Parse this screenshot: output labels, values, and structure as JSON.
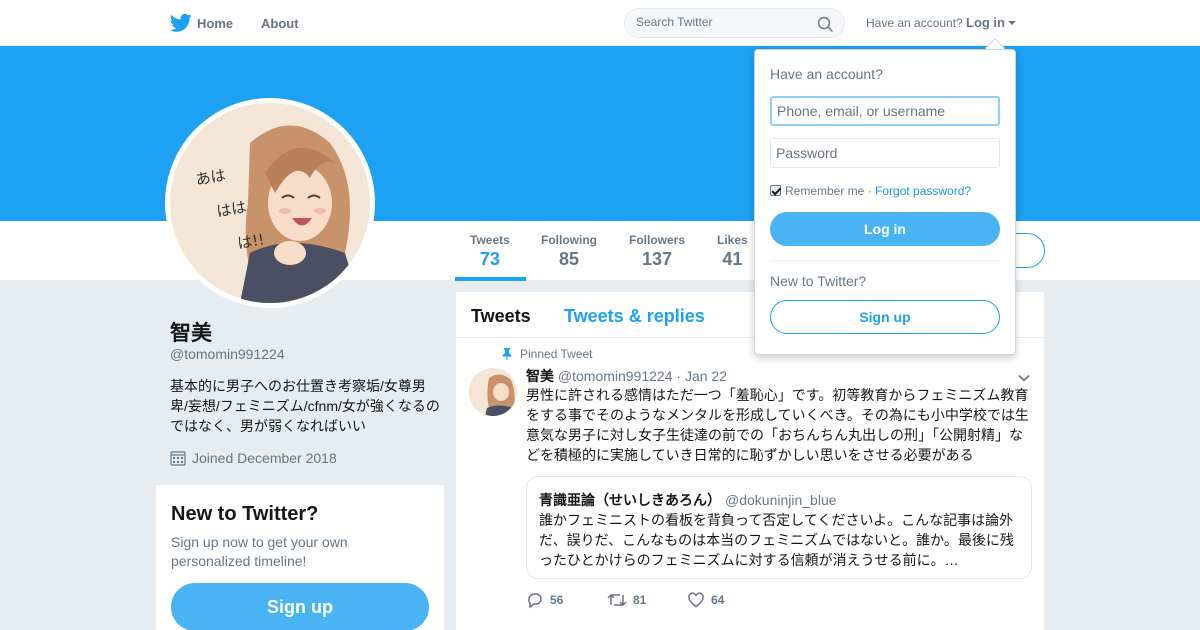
{
  "nav": {
    "home": "Home",
    "about": "About",
    "search_placeholder": "Search Twitter",
    "have_account": "Have an account?",
    "login": "Log in"
  },
  "profile": {
    "name": "智美",
    "handle": "@tomomin991224",
    "bio": "基本的に男子へのお仕置き考察垢/女尊男卑/妄想/フェミニズム/cfnm/女が強くなるのではなく、男が弱くなればいい",
    "joined": "Joined December 2018",
    "avatar_text": "あはははは!!"
  },
  "stats": [
    {
      "label": "Tweets",
      "value": "73"
    },
    {
      "label": "Following",
      "value": "85"
    },
    {
      "label": "Followers",
      "value": "137"
    },
    {
      "label": "Likes",
      "value": "41"
    }
  ],
  "signup_card": {
    "title": "New to Twitter?",
    "subtitle": "Sign up now to get your own personalized timeline!",
    "button": "Sign up"
  },
  "timeline": {
    "tabs": [
      "Tweets",
      "Tweets & replies"
    ],
    "tweet": {
      "pinned_label": "Pinned Tweet",
      "author": "智美",
      "meta": "@tomomin991224 · Jan 22",
      "text": "男性に許される感情はただ一つ「羞恥心」です。初等教育からフェミニズム教育をする事でそのようなメンタルを形成していくべき。その為にも小中学校では生意気な男子に対し女子生徒達の前での「おちんちん丸出しの刑」「公開射精」などを積極的に実施していき日常的に恥ずかしい思いをさせる必要がある",
      "quote": {
        "name": "青識亜論（せいしきあろん）",
        "handle": "@dokuninjin_blue",
        "text": "誰かフェミニストの看板を背負って否定してくださいよ。こんな記事は論外だ、誤りだ、こんなものは本当のフェミニズムではないと。誰か。最後に残ったひとかけらのフェミニズムに対する信頼が消えうせる前に。…"
      },
      "replies": "56",
      "retweets": "81",
      "likes": "64"
    }
  },
  "login_dropdown": {
    "title": "Have an account?",
    "username_placeholder": "Phone, email, or username",
    "password_placeholder": "Password",
    "remember": "Remember me",
    "separator": " · ",
    "forgot": "Forgot password?",
    "login_button": "Log in",
    "new_to_twitter": "New to Twitter?",
    "signup_button": "Sign up"
  },
  "colors": {
    "brand": "#1da1f2",
    "button": "#4ab3f4",
    "background": "#e6ecf0"
  }
}
